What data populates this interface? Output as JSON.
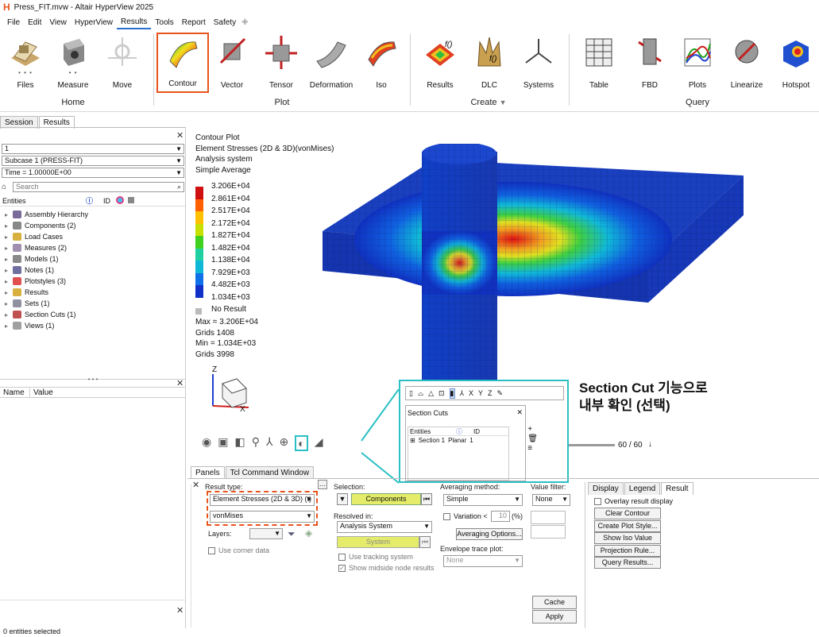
{
  "window": {
    "title": "Press_FIT.mvw - Altair HyperView 2025"
  },
  "menu": [
    "File",
    "Edit",
    "View",
    "HyperView",
    "Results",
    "Tools",
    "Report",
    "Safety"
  ],
  "ribbon": {
    "buttons": {
      "files": "Files",
      "measure": "Measure",
      "move": "Move",
      "contour": "Contour",
      "vector": "Vector",
      "tensor": "Tensor",
      "deformation": "Deformation",
      "iso": "Iso",
      "results": "Results",
      "dlc": "DLC",
      "systems": "Systems",
      "table": "Table",
      "fbd": "FBD",
      "plots": "Plots",
      "linearize": "Linearize",
      "hotspot": "Hotspot"
    },
    "groups": {
      "home": "Home",
      "plot": "Plot",
      "create": "Create",
      "query": "Query"
    }
  },
  "left": {
    "tabs": [
      "Session",
      "Results"
    ],
    "combo1": "1",
    "subcase": "Subcase 1 (PRESS-FIT)",
    "time": "Time = 1.00000E+00",
    "search_placeholder": "Search",
    "col_entities": "Entities",
    "col_id": "ID",
    "tree": [
      "Assembly Hierarchy",
      "Components (2)",
      "Load Cases",
      "Measures (2)",
      "Models (1)",
      "Notes (1)",
      "Plotstyles (3)",
      "Results",
      "Sets (1)",
      "Section Cuts (1)",
      "Views (1)"
    ],
    "prop_name": "Name",
    "prop_value": "Value"
  },
  "legend": {
    "lines": [
      "Contour Plot",
      "Element Stresses (2D & 3D)(vonMises)",
      "Analysis system",
      "Simple Average"
    ],
    "values": [
      "3.206E+04",
      "2.861E+04",
      "2.517E+04",
      "2.172E+04",
      "1.827E+04",
      "1.482E+04",
      "1.138E+04",
      "7.929E+03",
      "4.482E+03",
      "1.034E+03"
    ],
    "colors": [
      "#d01010",
      "#ff6000",
      "#ffc000",
      "#c8e000",
      "#40d020",
      "#20d0a0",
      "#10b8d8",
      "#1070e8",
      "#1030c8",
      "#0010a0"
    ],
    "no_result": "No Result",
    "stats": [
      "Max = 3.206E+04",
      "Grids 1408",
      "Min = 1.034E+03",
      "Grids 3998"
    ]
  },
  "triad": {
    "z": "Z",
    "x": "X"
  },
  "anim": {
    "frames": "60 / 60"
  },
  "callout": {
    "text_line1": "Section Cut 기능으로",
    "text_line2": "내부 확인 (선택)",
    "toolbar_labels": [
      "X",
      "Y",
      "Z"
    ],
    "panel_title": "Section Cuts",
    "col_entities": "Entities",
    "col_id": "ID",
    "row": {
      "name": "Section 1",
      "type": "Planar",
      "id": "1"
    }
  },
  "panels": {
    "tabs": [
      "Panels",
      "Tcl Command Window"
    ],
    "result_type_label": "Result type:",
    "result_type": "Element Stresses (2D & 3D) (t)",
    "component": "vonMises",
    "layers_label": "Layers:",
    "use_corner": "Use corner data",
    "selection_label": "Selection:",
    "components_btn": "Components",
    "resolved_label": "Resolved in:",
    "resolved": "Analysis System",
    "system_btn": "System",
    "use_tracking": "Use tracking system",
    "show_midside": "Show midside node results",
    "averaging_label": "Averaging method:",
    "averaging": "Simple",
    "variation": "Variation <",
    "variation_val": "10",
    "variation_unit": "(%)",
    "averaging_options": "Averaging Options...",
    "envelope_label": "Envelope trace plot:",
    "envelope": "None",
    "value_filter_label": "Value filter:",
    "value_filter": "None",
    "cache": "Cache",
    "apply": "Apply",
    "right_tabs": [
      "Display",
      "Legend",
      "Result"
    ],
    "overlay": "Overlay result display",
    "clear_contour": "Clear Contour",
    "create_plot_style": "Create Plot Style...",
    "show_iso": "Show Iso Value",
    "projection_rule": "Projection Rule...",
    "query_results": "Query Results..."
  },
  "status": "0 entities selected"
}
